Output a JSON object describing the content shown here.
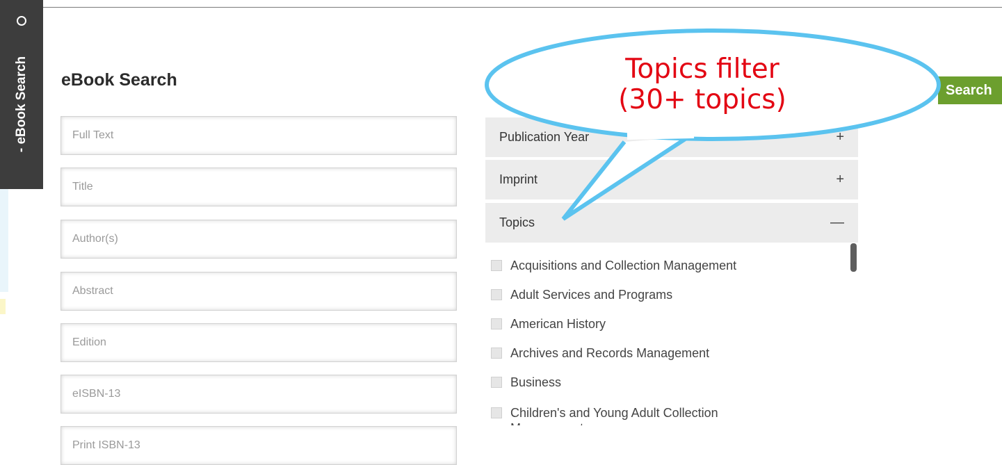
{
  "sidebar": {
    "tab_label": "-   eBook Search",
    "icon": "refresh-icon"
  },
  "page": {
    "title": "eBook Search"
  },
  "search_button": {
    "label": "Search",
    "color": "#6c9f2e"
  },
  "fields": [
    {
      "placeholder": "Full Text"
    },
    {
      "placeholder": "Title"
    },
    {
      "placeholder": "Author(s)"
    },
    {
      "placeholder": "Abstract"
    },
    {
      "placeholder": "Edition"
    },
    {
      "placeholder": "eISBN-13"
    },
    {
      "placeholder": "Print ISBN-13"
    }
  ],
  "filters": [
    {
      "label": "Publication Year",
      "sign": "+"
    },
    {
      "label": "Imprint",
      "sign": "+"
    },
    {
      "label": "Topics",
      "sign": "—"
    }
  ],
  "topics": [
    "Acquisitions and Collection Management",
    "Adult Services and Programs",
    "American History",
    "Archives and Records Management",
    "Business",
    "Children's and Young Adult Collection Management"
  ],
  "callout": {
    "line1": "Topics filter",
    "line2": "(30+ topics)",
    "color": "#e30613",
    "outline_color": "#5bc3ef"
  }
}
